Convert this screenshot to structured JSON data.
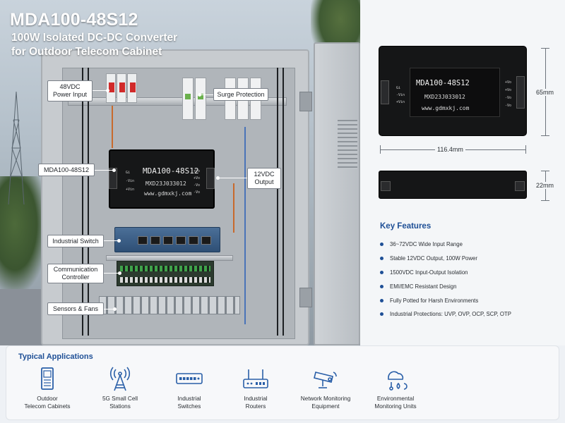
{
  "header": {
    "title": "MDA100-48S12",
    "subtitle_line1": "100W Isolated DC-DC Converter",
    "subtitle_line2": "for Outdoor Telecom Cabinet"
  },
  "callouts": {
    "power_input": [
      "48VDC",
      "Power Input"
    ],
    "surge": "Surge Protection",
    "module": "MDA100-48S12",
    "output": [
      "12VDC",
      "Output"
    ],
    "switch": "Industrial Switch",
    "controller": [
      "Communication",
      "Controller"
    ],
    "sensors": "Sensors & Fans"
  },
  "module_label": {
    "name": "MDA100-48S12",
    "code": "MXD23J033012",
    "url": "www.gdmxkj.com",
    "pins_in": [
      "Gi",
      "-Vin",
      "+Vin"
    ],
    "pins_out": [
      "+Vo",
      "+Vo",
      "-Vo",
      "-Vo"
    ]
  },
  "product": {
    "width_dim": "116.4mm",
    "height_dim": "65mm",
    "depth_dim": "22mm"
  },
  "key_features": {
    "title": "Key Features",
    "items": [
      "36~72VDC Wide Input Range",
      "Stable 12VDC Output, 100W Power",
      "1500VDC Input-Output Isolation",
      "EMI/EMC Resistant Design",
      "Fully Potted for Harsh Environments",
      "Industrial Protections: UVP, OVP, OCP, SCP, OTP"
    ]
  },
  "applications": {
    "title": "Typical Applications",
    "items": [
      {
        "label": [
          "Outdoor",
          "Telecom Cabinets"
        ],
        "icon": "cabinet-icon"
      },
      {
        "label": [
          "5G Small Cell",
          "Stations"
        ],
        "icon": "antenna-tower-icon"
      },
      {
        "label": [
          "Industrial",
          "Switches"
        ],
        "icon": "network-switch-icon"
      },
      {
        "label": [
          "Industrial",
          "Routers"
        ],
        "icon": "router-icon"
      },
      {
        "label": [
          "Network Monitoring",
          "Equipment"
        ],
        "icon": "security-camera-icon"
      },
      {
        "label": [
          "Environmental",
          "Monitoring Units"
        ],
        "icon": "environment-sensor-icon"
      }
    ]
  },
  "colors": {
    "accent": "#1e4f96",
    "module": "#151617",
    "breaker_toggle": "#d12a2a"
  }
}
